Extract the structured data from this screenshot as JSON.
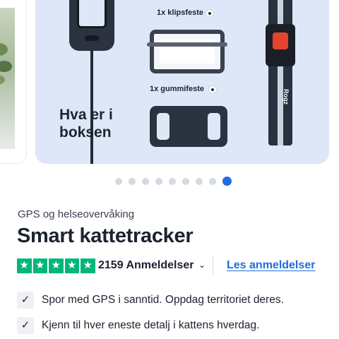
{
  "carousel": {
    "items": [
      {
        "label": "1x klipsfeste"
      },
      {
        "label": "1x gummifeste"
      }
    ],
    "box_title_line1": "Hva er i",
    "box_title_line2": "boksen",
    "collar_logo": "Rogz",
    "dot_count": 9,
    "active_index": 8
  },
  "product": {
    "subtitle": "GPS og helseovervåking",
    "title": "Smart kattetracker"
  },
  "rating": {
    "stars": 5,
    "star_glyph": "★",
    "count_text": "2159 Anmeldelser",
    "chevron": "⌄",
    "link_text": "Les anmeldelser",
    "trustpilot_color": "#00b67a",
    "link_color": "#1f6ee0"
  },
  "features": [
    {
      "check": "✓",
      "text": "Spor med GPS i sanntid. Oppdag territoriet deres."
    },
    {
      "check": "✓",
      "text": "Kjenn til hver eneste detalj i kattens hverdag."
    }
  ]
}
